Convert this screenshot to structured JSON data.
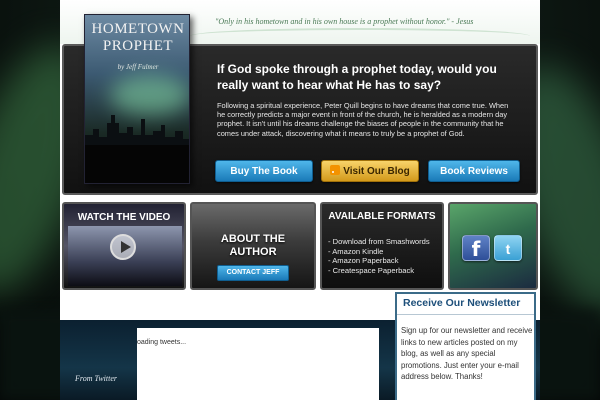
{
  "header": {
    "quote": "\"Only in his hometown and in his own house is a prophet without honor.\" - Jesus"
  },
  "book": {
    "title_line1": "HOMETOWN",
    "title_line2": "PROPHET",
    "author": "by Jeff Fulmer"
  },
  "hero": {
    "headline": "If God spoke through a prophet today, would you really want to hear what He has to say?",
    "description": "Following a spiritual experience, Peter Quill begins to have dreams that come true. When he correctly predicts a major event in front of the church, he is heralded as a modern day prophet. It isn't until his dreams challenge the biases of people in the community that he comes under attack, discovering what it means to truly be a prophet of God.",
    "buttons": {
      "buy": "Buy The Book",
      "blog": "Visit Our Blog",
      "reviews": "Book Reviews"
    }
  },
  "video": {
    "title": "WATCH THE VIDEO"
  },
  "author_box": {
    "title_line1": "ABOUT THE",
    "title_line2": "AUTHOR",
    "contact": "CONTACT JEFF"
  },
  "formats": {
    "title": "AVAILABLE FORMATS",
    "items": [
      "- Download from Smashwords",
      "- Amazon Kindle",
      "- Amazon Paperback",
      "- Createspace Paperback"
    ]
  },
  "social": {
    "facebook_glyph": "f",
    "twitter_glyph": "t"
  },
  "twitter": {
    "loading": "oading tweets...",
    "label": "From Twitter"
  },
  "newsletter": {
    "title": "Receive Our Newsletter",
    "body": "Sign up for our newsletter and receive links to new articles posted on my blog, as well as any special promotions. Just enter your e-mail address below. Thanks!"
  },
  "colors": {
    "accent_blue": "#1a7ab8",
    "accent_gold": "#d39a1b",
    "newsletter_title": "#1d4f7a"
  }
}
